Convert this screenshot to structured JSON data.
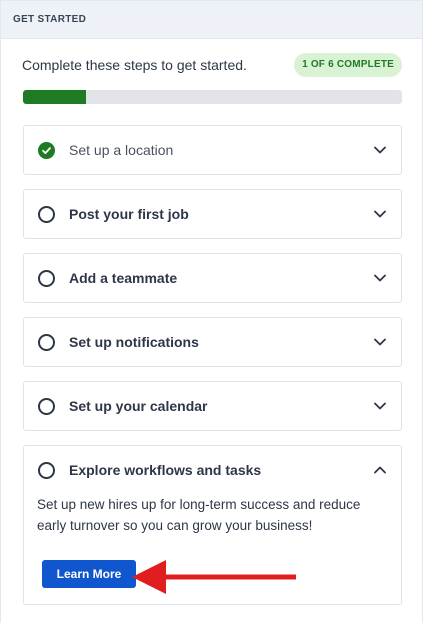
{
  "header": {
    "title": "GET STARTED"
  },
  "intro": {
    "text": "Complete these steps to get started.",
    "badge": "1 OF 6 COMPLETE"
  },
  "progress": {
    "completed": 1,
    "total": 6,
    "fraction": 0.167,
    "color": "#1e7b24"
  },
  "steps": [
    {
      "label": "Set up a location",
      "done": true,
      "expanded": false
    },
    {
      "label": "Post your first job",
      "done": false,
      "expanded": false
    },
    {
      "label": "Add a teammate",
      "done": false,
      "expanded": false
    },
    {
      "label": "Set up notifications",
      "done": false,
      "expanded": false
    },
    {
      "label": "Set up your calendar",
      "done": false,
      "expanded": false
    },
    {
      "label": "Explore workflows and tasks",
      "done": false,
      "expanded": true,
      "description": "Set up new hires up for long-term success and reduce early turnover so you can grow your business!",
      "button_label": "Learn More"
    }
  ],
  "colors": {
    "accent": "#0f56cf",
    "success": "#1e7b24",
    "annotation_arrow": "#e01e1e"
  }
}
